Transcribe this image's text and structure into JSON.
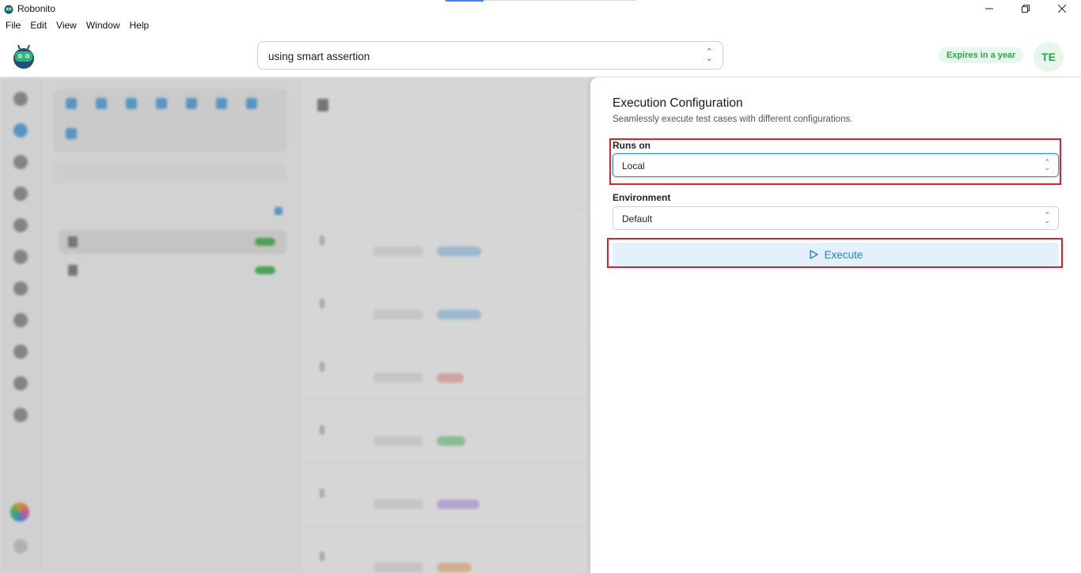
{
  "window": {
    "title": "Robonito",
    "controls": [
      "minimize",
      "maximize",
      "close"
    ]
  },
  "menu": [
    "File",
    "Edit",
    "View",
    "Window",
    "Help"
  ],
  "header": {
    "project_select_value": "using smart assertion",
    "expires_badge": "Expires in a year",
    "avatar_initials": "TE"
  },
  "exec_config": {
    "title": "Execution Configuration",
    "subtitle": "Seamlessly execute test cases with different configurations.",
    "runs_on_label": "Runs on",
    "runs_on_value": "Local",
    "environment_label": "Environment",
    "environment_value": "Default",
    "execute_label": "Execute"
  },
  "colors": {
    "accent": "#2d7fd3",
    "execute_bg": "#e3f1fc",
    "badge_green": "#2ea44f",
    "highlight_red": "#e0202a"
  }
}
